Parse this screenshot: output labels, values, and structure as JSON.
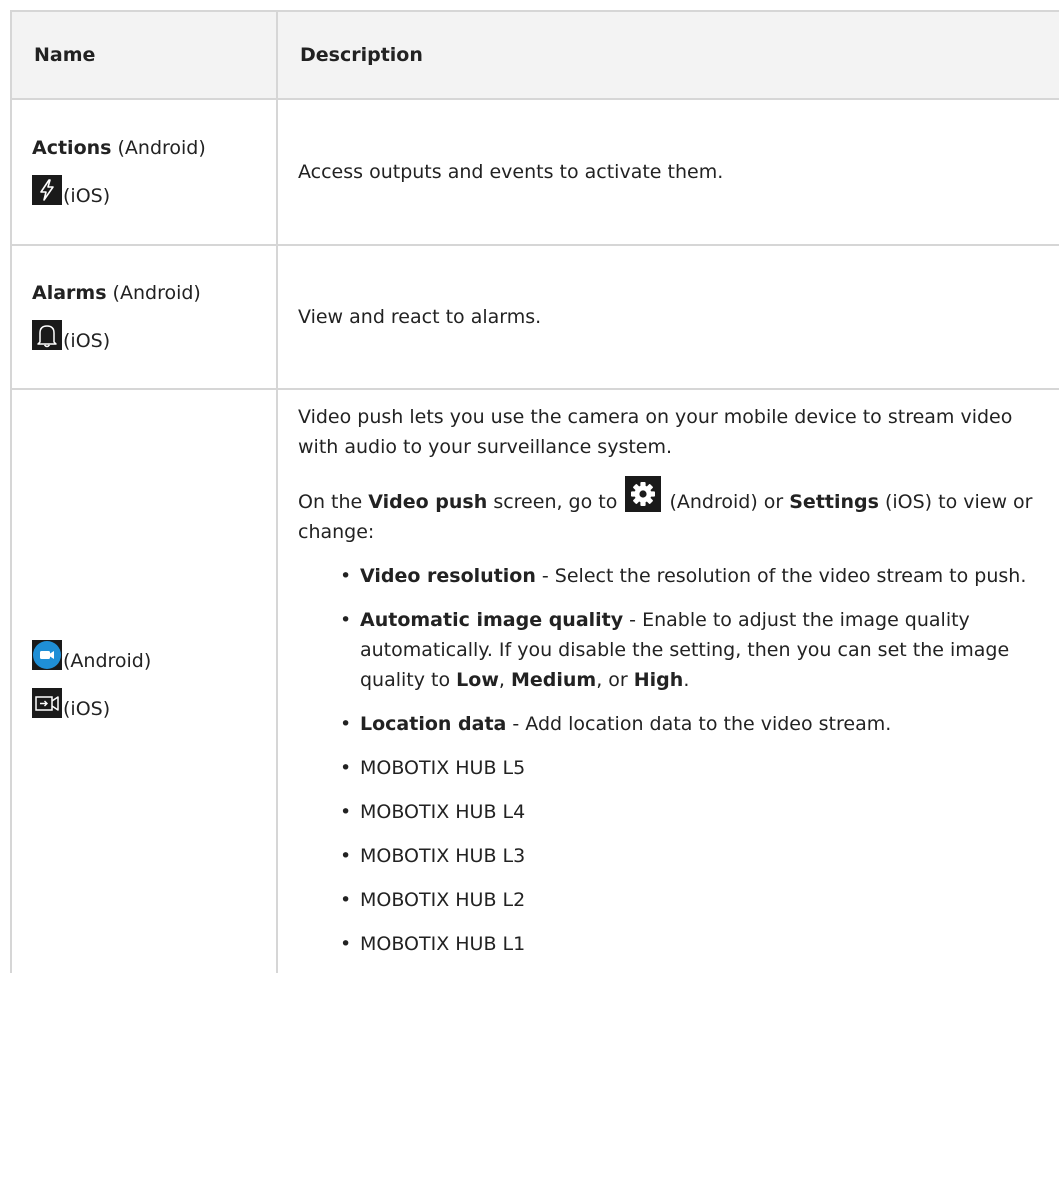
{
  "table": {
    "headers": [
      "Name",
      "Description"
    ],
    "rows": [
      {
        "name_bold": "Actions",
        "name_rest": " (Android)",
        "ios_label": "(iOS)",
        "ios_icon": "lightning-bolt-icon",
        "description": "Access outputs and events to activate them."
      },
      {
        "name_bold": "Alarms",
        "name_rest": " (Android)",
        "ios_label": "(iOS)",
        "ios_icon": "bell-icon",
        "description": "View and react to alarms."
      },
      {
        "android_icon": "video-camera-icon",
        "android_label": "(Android)",
        "ios_icon": "video-push-icon",
        "ios_label": "(iOS)",
        "intro": "Video push lets you use the camera on your mobile device to stream video with audio to your surveillance system.",
        "settings_p1": "On the ",
        "settings_b1": "Video push",
        "settings_p2": " screen, go to ",
        "settings_icon": "gear-icon",
        "settings_p3": " (Android) or ",
        "settings_b2": "Settings",
        "settings_p4": " (iOS) to view or change:",
        "bullets": [
          {
            "bold": "Video resolution",
            "text": " - Select the resolution of the video stream to push."
          },
          {
            "bold": "Automatic image quality",
            "text": " - Enable to adjust the image quality automatically. If you disable the setting, then you can set the image quality to ",
            "b_low": "Low",
            "sep1": ", ",
            "b_med": "Medium",
            "sep2": ", or ",
            "b_high": "High",
            "end": "."
          },
          {
            "bold": "Location data",
            "text": " - Add location data to the video stream."
          },
          {
            "text": "MOBOTIX HUB L5"
          },
          {
            "text": "MOBOTIX HUB L4"
          },
          {
            "text": "MOBOTIX HUB L3"
          },
          {
            "text": "MOBOTIX HUB L2"
          },
          {
            "text": "MOBOTIX HUB L1"
          }
        ]
      }
    ]
  },
  "colors": {
    "border": "#d6d6d6",
    "header_bg": "#f3f3f3",
    "camera_blue": "#1f8fd6"
  }
}
